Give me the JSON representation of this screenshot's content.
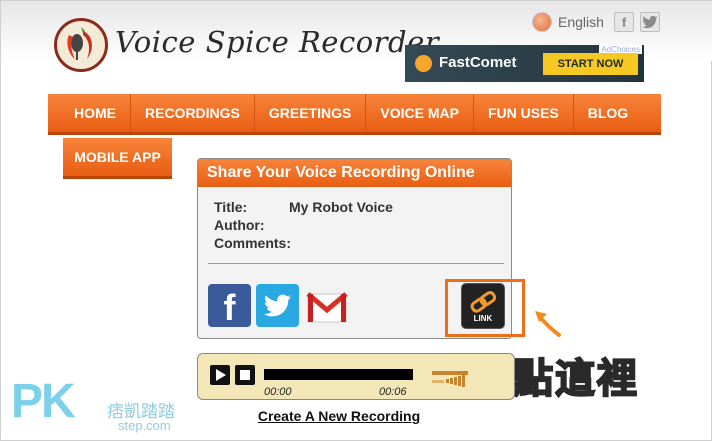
{
  "brand": {
    "title": "Voice Spice Recorder",
    "logo_icon": "microphone-chili-logo"
  },
  "header": {
    "language": "English",
    "social": {
      "facebook": "f",
      "twitter": "t"
    }
  },
  "ad": {
    "choices": "AdChoices",
    "brand": "FastComet",
    "cta": "START NOW"
  },
  "nav": {
    "items": [
      "HOME",
      "RECORDINGS",
      "GREETINGS",
      "VOICE MAP",
      "FUN USES",
      "BLOG"
    ],
    "second_row": "MOBILE APP"
  },
  "share_panel": {
    "heading": "Share Your Voice Recording Online",
    "fields": [
      {
        "label": "Title:",
        "value": "My Robot Voice"
      },
      {
        "label": "Author:",
        "value": ""
      },
      {
        "label": "Comments:",
        "value": ""
      }
    ],
    "buttons": {
      "facebook": "f",
      "link": "LINK"
    }
  },
  "annotation": "點這裡",
  "player": {
    "current_time": "00:00",
    "total_time": "00:06"
  },
  "create_link": "Create A New Recording",
  "watermark": {
    "logo": "PK",
    "chinese": "痞凱踏踏",
    "url": "step.com"
  },
  "colors": {
    "accent": "#f26f22",
    "highlight": "#f06d1a",
    "facebook": "#3a5a99",
    "twitter": "#29a8e1",
    "player_bg": "#f3e7b8"
  }
}
